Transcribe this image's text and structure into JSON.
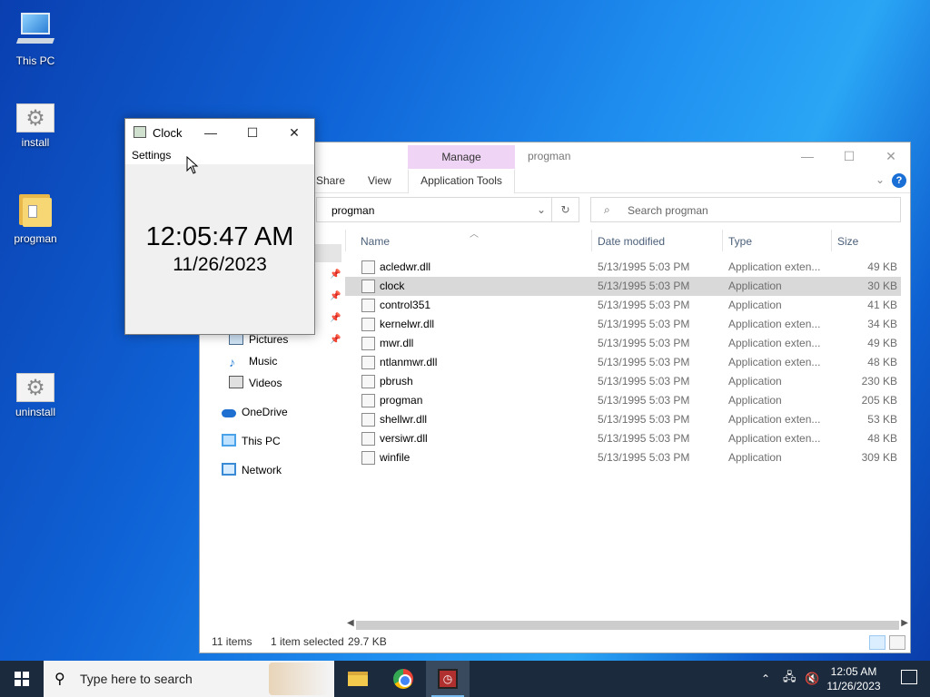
{
  "desktop": {
    "icons": [
      {
        "label": "This PC"
      },
      {
        "label": "install"
      },
      {
        "label": "progman"
      },
      {
        "label": "uninstall"
      }
    ]
  },
  "explorer": {
    "title": "progman",
    "manage_tab": "Manage",
    "ribbon": {
      "share": "Share",
      "view": "View",
      "app_tools": "Application Tools"
    },
    "address": "progman",
    "search_placeholder": "Search progman",
    "nav": {
      "pictures": "Pictures",
      "music": "Music",
      "videos": "Videos",
      "onedrive": "OneDrive",
      "thispc": "This PC",
      "network": "Network"
    },
    "columns": {
      "name": "Name",
      "date": "Date modified",
      "type": "Type",
      "size": "Size"
    },
    "files": [
      {
        "name": "acledwr.dll",
        "date": "5/13/1995 5:03 PM",
        "type": "Application exten...",
        "size": "49 KB"
      },
      {
        "name": "clock",
        "date": "5/13/1995 5:03 PM",
        "type": "Application",
        "size": "30 KB"
      },
      {
        "name": "control351",
        "date": "5/13/1995 5:03 PM",
        "type": "Application",
        "size": "41 KB"
      },
      {
        "name": "kernelwr.dll",
        "date": "5/13/1995 5:03 PM",
        "type": "Application exten...",
        "size": "34 KB"
      },
      {
        "name": "mwr.dll",
        "date": "5/13/1995 5:03 PM",
        "type": "Application exten...",
        "size": "49 KB"
      },
      {
        "name": "ntlanmwr.dll",
        "date": "5/13/1995 5:03 PM",
        "type": "Application exten...",
        "size": "48 KB"
      },
      {
        "name": "pbrush",
        "date": "5/13/1995 5:03 PM",
        "type": "Application",
        "size": "230 KB"
      },
      {
        "name": "progman",
        "date": "5/13/1995 5:03 PM",
        "type": "Application",
        "size": "205 KB"
      },
      {
        "name": "shellwr.dll",
        "date": "5/13/1995 5:03 PM",
        "type": "Application exten...",
        "size": "53 KB"
      },
      {
        "name": "versiwr.dll",
        "date": "5/13/1995 5:03 PM",
        "type": "Application exten...",
        "size": "48 KB"
      },
      {
        "name": "winfile",
        "date": "5/13/1995 5:03 PM",
        "type": "Application",
        "size": "309 KB"
      }
    ],
    "selected_index": 1,
    "status": {
      "items": "11 items",
      "selected": "1 item selected",
      "size": "29.7 KB"
    }
  },
  "clock_window": {
    "title": "Clock",
    "menu_settings": "Settings",
    "time": "12:05:47 AM",
    "date": "11/26/2023"
  },
  "taskbar": {
    "search_placeholder": "Type here to search",
    "time": "12:05 AM",
    "date": "11/26/2023"
  },
  "colors": {
    "manage_tab": "#f0d4f6",
    "selection": "#d9d9d9",
    "taskbar": "#1b2a3c",
    "accent": "#1a6fd6"
  }
}
